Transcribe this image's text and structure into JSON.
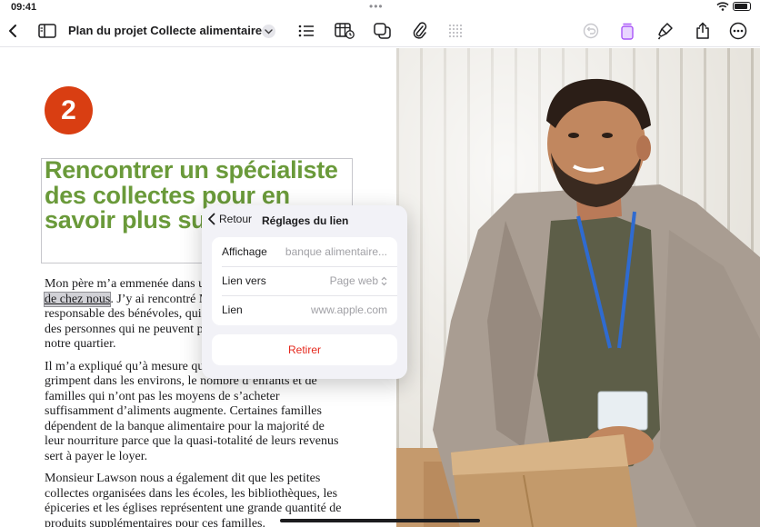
{
  "status_bar": {
    "time": "09:41"
  },
  "toolbar": {
    "document_title": "Plan du projet Collecte alimentaire...",
    "icons": [
      "back-icon",
      "sidebar-icon",
      "list-icon",
      "table-icon",
      "shapes-icon",
      "attachment-icon",
      "grid-icon",
      "undo-icon",
      "format-icon",
      "brush-icon",
      "share-icon",
      "more-icon"
    ]
  },
  "document": {
    "step_number": "2",
    "heading": "Rencontrer un spécialiste des collectes pour en savoir plus sur",
    "paragraph1": {
      "before_link": "Mon père m’a emmenée dans une banque alimentaire ",
      "link_text": "près de chez nous",
      "after_link": ". J’y ai rencontré Monsieur Lawson, le responsable des bénévoles, qui m’a expliqué le problème des personnes qui ne peuvent pas manger à leur faim dans notre quartier."
    },
    "paragraph2": "Il m’a expliqué qu’à mesure que les coûts augmentent et grimpent dans les environs, le nombre d’enfants et de familles qui n’ont pas les moyens de s’acheter suffisamment d’aliments augmente. Certaines familles dépendent de la banque alimentaire pour la majorité de leur nourriture parce que la quasi-totalité de leurs revenus sert à payer le loyer.",
    "paragraph3": "Monsieur Lawson nous a également dit que les petites collectes organisées dans les écoles, les bibliothèques, les épiceries et les églises représentent une grande quantité de produits supplémentaires pour ces familles."
  },
  "link_popover": {
    "back_label": "Retour",
    "title": "Réglages du lien",
    "rows": [
      {
        "label": "Affichage",
        "value": "banque alimentaire..."
      },
      {
        "label": "Lien vers",
        "value": "Page web"
      },
      {
        "label": "Lien",
        "value": "www.apple.com"
      }
    ],
    "remove_label": "Retirer"
  },
  "colors": {
    "heading_green": "#6a9a3a",
    "badge_red": "#d93e12",
    "remove_red": "#e5271c",
    "highlight_purple": "#a855f7"
  }
}
